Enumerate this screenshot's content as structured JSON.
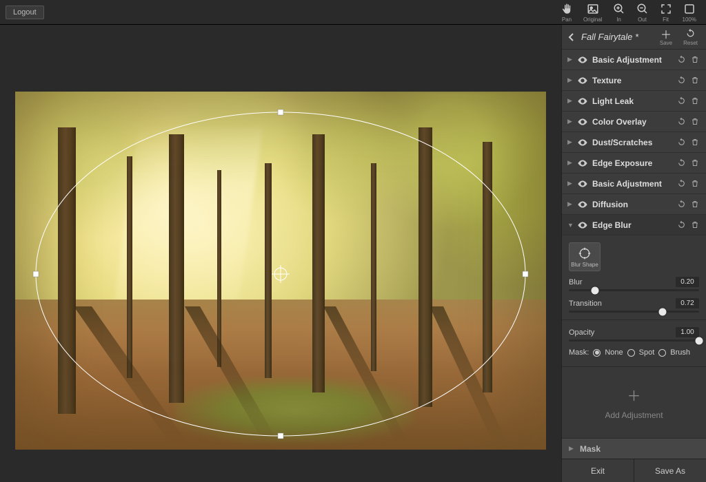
{
  "topbar": {
    "logout": "Logout",
    "tools": [
      {
        "key": "pan",
        "label": "Pan"
      },
      {
        "key": "original",
        "label": "Original"
      },
      {
        "key": "in",
        "label": "In"
      },
      {
        "key": "out",
        "label": "Out"
      },
      {
        "key": "fit",
        "label": "Fit"
      },
      {
        "key": "100",
        "label": "100%"
      }
    ]
  },
  "panel": {
    "title": "Fall Fairytale *",
    "save": "Save",
    "reset": "Reset"
  },
  "adjustments": [
    {
      "name": "Basic Adjustment"
    },
    {
      "name": "Texture"
    },
    {
      "name": "Light Leak"
    },
    {
      "name": "Color Overlay"
    },
    {
      "name": "Dust/Scratches"
    },
    {
      "name": "Edge Exposure"
    },
    {
      "name": "Basic Adjustment"
    },
    {
      "name": "Diffusion"
    },
    {
      "name": "Edge Blur",
      "expanded": true
    }
  ],
  "edgeBlur": {
    "blurShapeLabel": "Blur Shape",
    "sliders": {
      "blur": {
        "label": "Blur",
        "value": "0.20",
        "pos": 0.2
      },
      "transition": {
        "label": "Transition",
        "value": "0.72",
        "pos": 0.72
      },
      "opacity": {
        "label": "Opacity",
        "value": "1.00",
        "pos": 1.0
      }
    },
    "mask": {
      "label": "Mask:",
      "options": [
        "None",
        "Spot",
        "Brush"
      ],
      "selected": "None"
    }
  },
  "addAdjustment": "Add Adjustment",
  "maskSection": "Mask",
  "bottom": {
    "exit": "Exit",
    "saveAs": "Save As"
  }
}
